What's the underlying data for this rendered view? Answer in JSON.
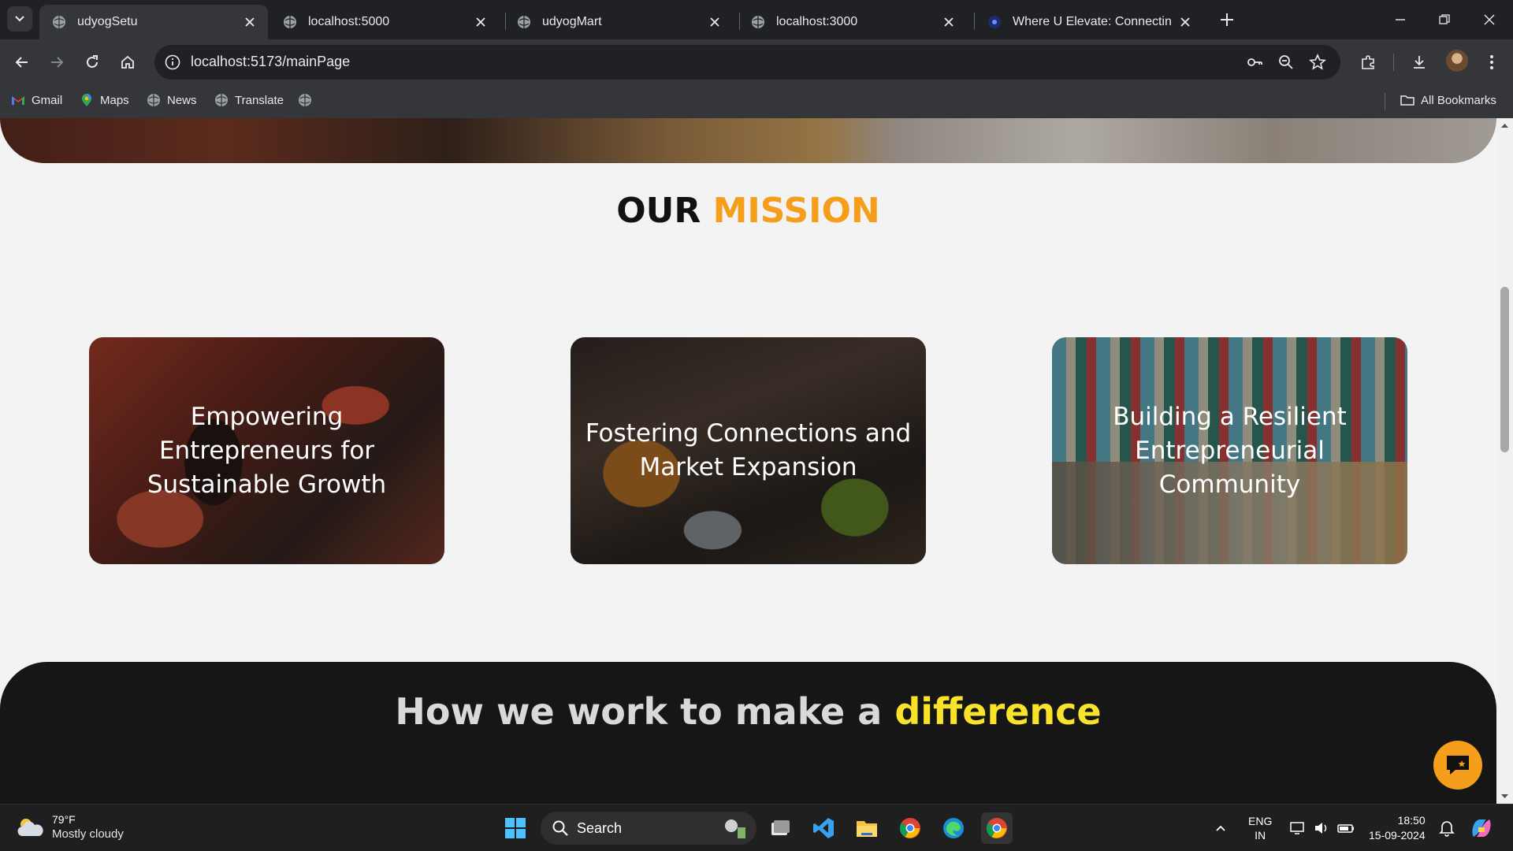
{
  "browser": {
    "tabs": [
      {
        "title": "udyogSetu",
        "active": true
      },
      {
        "title": "localhost:5000",
        "active": false
      },
      {
        "title": "udyogMart",
        "active": false
      },
      {
        "title": "localhost:3000",
        "active": false
      },
      {
        "title": "Where U Elevate: Connecting ne",
        "active": false
      }
    ],
    "url": "localhost:5173/mainPage",
    "bookmarks": [
      {
        "label": "Gmail"
      },
      {
        "label": "Maps"
      },
      {
        "label": "News"
      },
      {
        "label": "Translate"
      }
    ],
    "all_bookmarks_label": "All Bookmarks"
  },
  "page": {
    "mission": {
      "title_part1": "OUR",
      "title_part2": "MISSION",
      "cards": [
        {
          "caption": "Empowering Entrepreneurs for Sustainable Growth"
        },
        {
          "caption": "Fostering Connections and Market Expansion"
        },
        {
          "caption": "Building a Resilient Entrepreneurial Community"
        }
      ]
    },
    "difference": {
      "title_part1": "How we work to make a",
      "title_part2": "difference"
    }
  },
  "taskbar": {
    "weather": {
      "temp": "79°F",
      "condition": "Mostly cloudy"
    },
    "search_placeholder": "Search",
    "lang_line1": "ENG",
    "lang_line2": "IN",
    "time": "18:50",
    "date": "15-09-2024"
  },
  "colors": {
    "mission_accent": "#f59e1b",
    "difference_accent": "#f8e22a",
    "chat_button": "#f59e1b"
  }
}
